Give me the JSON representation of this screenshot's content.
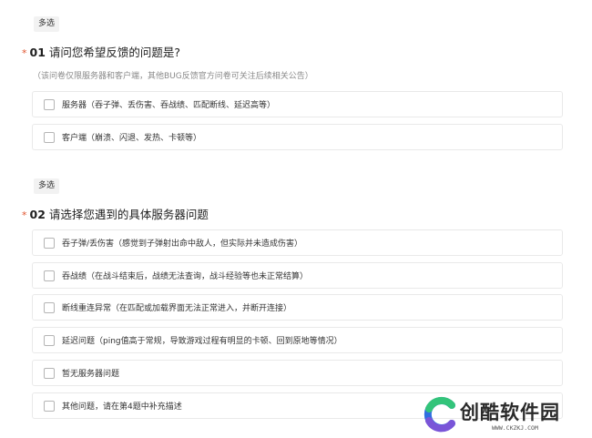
{
  "q1": {
    "tag": "多选",
    "star": "*",
    "number": "01",
    "title": "请问您希望反馈的问题是?",
    "hint": "（该问卷仅限服务器和客户端，其他BUG反馈官方问卷可关注后续相关公告）",
    "options": [
      {
        "label": "服务器（吞子弹、丢伤害、吞战绩、匹配断线、延迟高等）",
        "checked": false
      },
      {
        "label": "客户端（崩溃、闪退、发热、卡顿等）",
        "checked": false
      }
    ]
  },
  "q2": {
    "tag": "多选",
    "star": "*",
    "number": "02",
    "title": "请选择您遇到的具体服务器问题",
    "options": [
      {
        "label": "吞子弹/丢伤害（感觉到子弹射出命中敌人，但实际并未造成伤害）",
        "checked": false
      },
      {
        "label": "吞战绩（在战斗结束后，战绩无法查询，战斗经验等也未正常结算）",
        "checked": false
      },
      {
        "label": "断线重连异常（在匹配或加载界面无法正常进入，并断开连接）",
        "checked": false
      },
      {
        "label": "延迟问题（ping值高于常规，导致游戏过程有明显的卡顿、回到原地等情况）",
        "checked": false
      },
      {
        "label": "暂无服务器问题",
        "checked": false
      },
      {
        "label": "其他问题，请在第4题中补充描述",
        "checked": false
      }
    ]
  },
  "watermark": {
    "name": "创酷软件园",
    "url": "WWW.CKZKJ.COM",
    "colors": {
      "green": "#33c47a",
      "blue": "#2f6ee0",
      "purple": "#7a55d8"
    }
  }
}
